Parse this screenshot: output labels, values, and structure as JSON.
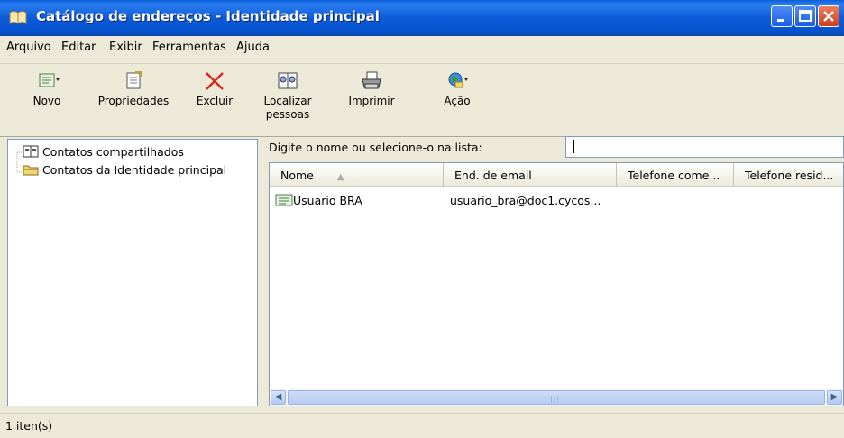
{
  "window": {
    "title": "Catálogo de endereços - Identidade principal"
  },
  "menu": [
    "Arquivo",
    "Editar",
    "Exibir",
    "Ferramentas",
    "Ajuda"
  ],
  "toolbar": {
    "new_label": "Novo",
    "properties_label": "Propriedades",
    "delete_label": "Excluir",
    "find_line1": "Localizar",
    "find_line2": "pessoas",
    "print_label": "Imprimir",
    "action_label": "Ação"
  },
  "tree": {
    "items": [
      "Contatos compartilhados",
      "Contatos da Identidade principal"
    ]
  },
  "search": {
    "label": "Digite o nome ou selecione-o na lista:",
    "value": ""
  },
  "list": {
    "columns": [
      "Nome",
      "End. de email",
      "Telefone come...",
      "Telefone resid..."
    ],
    "rows": [
      {
        "name": "Usuario BRA",
        "email": "usuario_bra@doc1.cycos..."
      }
    ]
  },
  "status": {
    "text": "1 iten(s)"
  }
}
